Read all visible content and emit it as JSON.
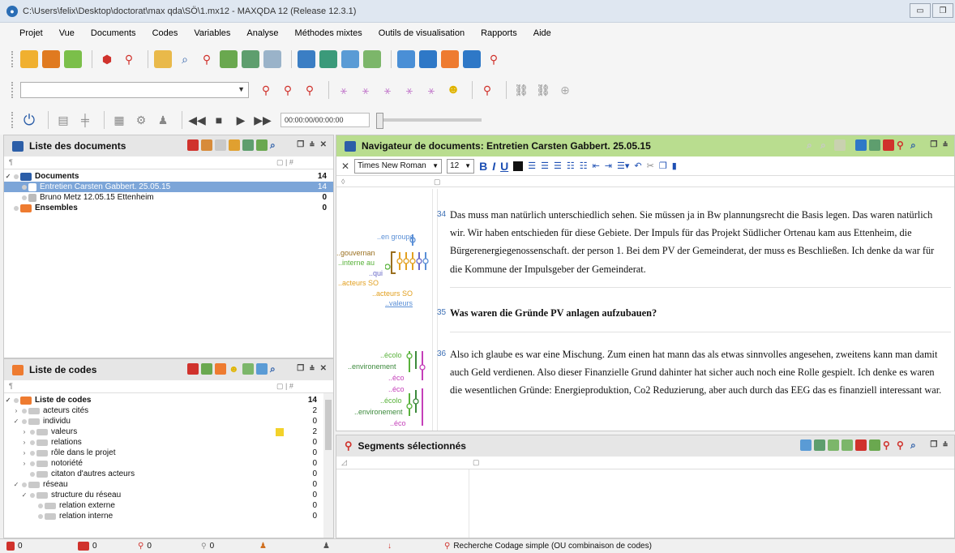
{
  "window": {
    "title": "C:\\Users\\felix\\Desktop\\doctorat\\max qda\\SÖ\\1.mx12 - MAXQDA 12 (Release 12.3.1)"
  },
  "menu": [
    "Projet",
    "Vue",
    "Documents",
    "Codes",
    "Variables",
    "Analyse",
    "Méthodes mixtes",
    "Outils de visualisation",
    "Rapports",
    "Aide"
  ],
  "toolbar": {
    "timecode": "00:00:00/00:00:00"
  },
  "docs_panel": {
    "title": "Liste des documents",
    "rows": [
      {
        "label": "Documents",
        "count": "14"
      },
      {
        "label": "Entretien Carsten Gabbert. 25.05.15",
        "count": "14"
      },
      {
        "label": "Bruno Metz 12.05.15 Ettenheim",
        "count": "0"
      },
      {
        "label": "Ensembles",
        "count": "0"
      }
    ]
  },
  "codes_panel": {
    "title": "Liste de codes",
    "rows": [
      {
        "label": "Liste de codes",
        "count": "14"
      },
      {
        "label": "acteurs cités",
        "count": "2"
      },
      {
        "label": "individu",
        "count": "0"
      },
      {
        "label": "valeurs",
        "count": "2"
      },
      {
        "label": "relations",
        "count": "0"
      },
      {
        "label": "rôle dans le projet",
        "count": "0"
      },
      {
        "label": "notoriété",
        "count": "0"
      },
      {
        "label": "citaton d'autres acteurs",
        "count": "0"
      },
      {
        "label": "réseau",
        "count": "0"
      },
      {
        "label": "structure du réseau",
        "count": "0"
      },
      {
        "label": "relation externe",
        "count": "0"
      },
      {
        "label": "relation interne",
        "count": "0"
      }
    ]
  },
  "browser": {
    "title": "Navigateur de documents: Entretien Carsten Gabbert. 25.05.15",
    "font": "Times New Roman",
    "size": "12",
    "code_labels_1": [
      "..en groupe",
      "..gouvernan",
      "..interne au",
      "..qui",
      "..acteurs SO",
      "..acteurs SO",
      "..valeurs"
    ],
    "code_labels_2": [
      "..écolo",
      "..environement",
      "..éco",
      "..éco",
      "..écolo",
      "..environement",
      "..éco"
    ],
    "paragraphs": [
      {
        "num": "34",
        "text": "Das muss man natürlich unterschiedlich sehen. Sie müssen ja in Bw plannungsrecht die Basis legen. Das waren natürlich wir. Wir haben entschieden für diese Gebiete. Der Impuls für das Projekt Südlicher Ortenau kam aus Ettenheim, die Bürgerenergiegenossenschaft. der person 1. Bei dem PV der Gemeinderat, der muss es Beschließen. Ich denke da war für die Kommune der Impulsgeber der Gemeinderat."
      },
      {
        "num": "35",
        "text": "Was waren die Gründe PV anlagen aufzubauen?"
      },
      {
        "num": "36",
        "text": "Also ich glaube es war eine Mischung. Zum einen hat mann das als etwas sinnvolles angesehen, zweitens kann man damit auch Geld verdienen. Also dieser Finanzielle Grund dahinter hat sicher auch noch eine Rolle gespielt. Ich denke es waren die wesentlichen Gründe: Energieproduktion, Co2 Reduzierung, aber auch durch das EEG das es finanziell interessant war."
      }
    ]
  },
  "segments": {
    "title": "Segments sélectionnés"
  },
  "status": {
    "c1": "0",
    "c2": "0",
    "c3": "0",
    "c4": "0",
    "search": "Recherche Codage simple (OU combinaison de codes)"
  }
}
